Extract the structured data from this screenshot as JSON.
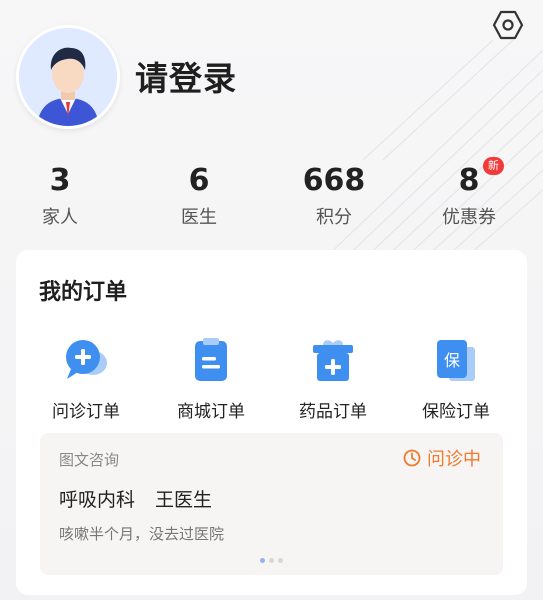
{
  "header": {
    "login_text": "请登录"
  },
  "stats": [
    {
      "value": "3",
      "label": "家人"
    },
    {
      "value": "6",
      "label": "医生"
    },
    {
      "value": "668",
      "label": "积分"
    },
    {
      "value": "8",
      "label": "优惠券",
      "badge": "新"
    }
  ],
  "orders": {
    "title": "我的订单",
    "items": [
      {
        "label": "问诊订单",
        "icon": "chat-plus-icon"
      },
      {
        "label": "商城订单",
        "icon": "clipboard-icon"
      },
      {
        "label": "药品订单",
        "icon": "medicine-box-icon"
      },
      {
        "label": "保险订单",
        "icon": "insurance-icon",
        "glyph": "保"
      }
    ]
  },
  "consultation": {
    "type": "图文咨询",
    "status": "问诊中",
    "department": "呼吸内科",
    "doctor": "王医生",
    "description": "咳嗽半个月，没去过医院",
    "pager": {
      "total": 3,
      "active": 1
    }
  },
  "colors": {
    "accent_blue": "#3f8ff0",
    "status_orange": "#f07a2e",
    "badge_red": "#f23a3a"
  }
}
